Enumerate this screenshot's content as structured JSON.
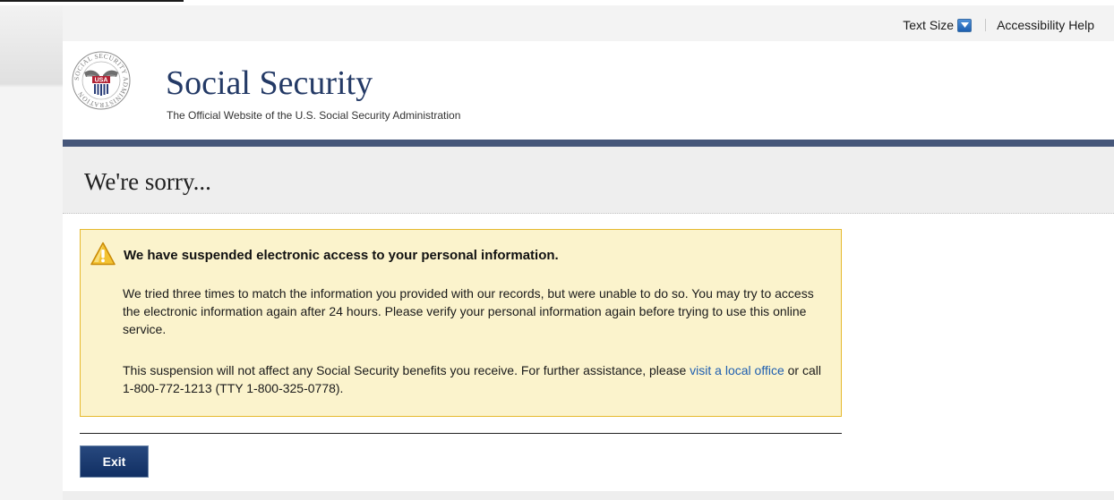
{
  "utility_bar": {
    "text_size_label": "Text Size",
    "text_size_icon": "dropdown-arrow-icon",
    "accessibility_help_label": "Accessibility Help"
  },
  "header": {
    "logo_icon": "ssa-seal-logo",
    "logo_text": "SOCIAL SECURITY ADMINISTRATION",
    "logo_badge": "USA",
    "site_title": "Social Security",
    "tagline": "The Official Website of the U.S. Social Security Administration"
  },
  "page": {
    "title": "We're sorry..."
  },
  "alert": {
    "icon": "warning-icon",
    "heading": "We have suspended electronic access to your personal information.",
    "paragraph1": "We tried three times to match the information you provided with our records, but were unable to do so. You may try to access the electronic information again after 24 hours. Please verify your personal information again before trying to use this online service.",
    "paragraph2_before_link": "This suspension will not affect any Social Security benefits you receive. For further assistance, please ",
    "link_label": "visit a local office",
    "paragraph2_after_link": " or call 1-800-772-1213 (TTY 1-800-325-0778)."
  },
  "actions": {
    "exit_label": "Exit"
  },
  "colors": {
    "brand_navy": "#243a66",
    "header_rule": "#46577a",
    "alert_background": "#fbf3cc",
    "alert_border": "#e6b92d",
    "link": "#1f5fb0",
    "button": "#1b3a70"
  }
}
